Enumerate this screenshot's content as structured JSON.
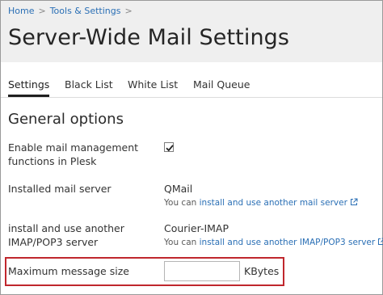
{
  "breadcrumb": [
    {
      "label": "Home"
    },
    {
      "label": "Tools & Settings"
    }
  ],
  "breadcrumb_separator": ">",
  "page_title": "Server-Wide Mail Settings",
  "tabs": [
    {
      "label": "Settings",
      "active": true
    },
    {
      "label": "Black List",
      "active": false
    },
    {
      "label": "White List",
      "active": false
    },
    {
      "label": "Mail Queue",
      "active": false
    }
  ],
  "section_title": "General options",
  "fields": {
    "mail_management": {
      "label": "Enable mail management functions in Plesk",
      "checked": true
    },
    "mail_server": {
      "label": "Installed mail server",
      "value": "QMail",
      "hint_prefix": "You can ",
      "hint_link": "install and use another mail server"
    },
    "imap_server": {
      "label": "install and use another IMAP/POP3 server",
      "value": "Courier-IMAP",
      "hint_prefix": "You can ",
      "hint_link": "install and use another IMAP/POP3 server"
    },
    "max_message_size": {
      "label": "Maximum message size",
      "value": "",
      "unit": "KBytes"
    }
  },
  "colors": {
    "link": "#2a6fb5",
    "highlight_border": "#c0272d",
    "header_bg": "#efefef"
  },
  "icons": {
    "checkmark": "check-icon",
    "external_link": "external-link-icon",
    "breadcrumb_separator": "chevron-right-icon"
  }
}
